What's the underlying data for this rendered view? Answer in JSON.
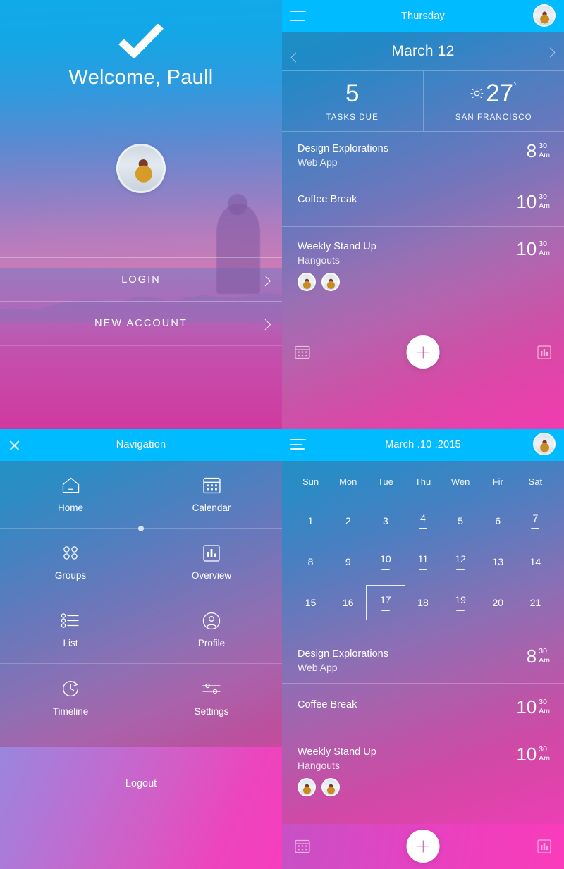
{
  "welcome": {
    "check_icon": "check-icon",
    "title": "Welcome, Paull",
    "avatar_icon": "user-avatar",
    "login_label": "LOGIN",
    "new_account_label": "NEW ACCOUNT",
    "chevron_icon": "chevron-right-icon"
  },
  "dashboard": {
    "appbar": {
      "menu_icon": "hamburger-menu-icon",
      "title": "Thursday",
      "avatar_icon": "user-avatar"
    },
    "date_nav": {
      "prev_icon": "chevron-left-icon",
      "date": "March 12",
      "next_icon": "chevron-right-icon"
    },
    "stats": [
      {
        "value": "5",
        "label": "TASKS DUE",
        "icon": ""
      },
      {
        "value": "27",
        "degree": "`",
        "label": "SAN FRANCISCO",
        "icon": "sun-icon"
      }
    ],
    "events": [
      {
        "title": "Design Explorations",
        "subtitle": "Web App",
        "hour": "8",
        "minutes": "30",
        "meridiem": "Am",
        "people": 0
      },
      {
        "title": "Coffee Break",
        "subtitle": "",
        "hour": "10",
        "minutes": "30",
        "meridiem": "Am",
        "people": 0
      },
      {
        "title": "Weekly Stand Up",
        "subtitle": "Hangouts",
        "hour": "10",
        "minutes": "30",
        "meridiem": "Am",
        "people": 2
      }
    ],
    "actions": {
      "left_icon": "calendar-icon",
      "add_icon": "plus-icon",
      "right_icon": "chart-bars-icon"
    }
  },
  "navigation": {
    "appbar": {
      "close_icon": "close-icon",
      "title": "Navigation"
    },
    "items": [
      {
        "label": "Home",
        "icon": "home-icon"
      },
      {
        "label": "Calendar",
        "icon": "calendar-icon"
      },
      {
        "label": "Groups",
        "icon": "groups-icon"
      },
      {
        "label": "Overview",
        "icon": "chart-bars-icon"
      },
      {
        "label": "List",
        "icon": "list-icon"
      },
      {
        "label": "Profile",
        "icon": "profile-icon"
      },
      {
        "label": "Timeline",
        "icon": "timeline-clock-icon"
      },
      {
        "label": "Settings",
        "icon": "sliders-icon"
      }
    ],
    "page_indicator": "page-dot",
    "logout_label": "Logout"
  },
  "calendar": {
    "appbar": {
      "menu_icon": "hamburger-menu-icon",
      "title": "March .10 ,2015",
      "avatar_icon": "user-avatar"
    },
    "weekdays": [
      "Sun",
      "Mon",
      "Tue",
      "Thu",
      "Wen",
      "Fir",
      "Sat"
    ],
    "weeks": [
      [
        {
          "day": "1",
          "event": false,
          "selected": false
        },
        {
          "day": "2",
          "event": false,
          "selected": false
        },
        {
          "day": "3",
          "event": false,
          "selected": false
        },
        {
          "day": "4",
          "event": true,
          "selected": false
        },
        {
          "day": "5",
          "event": false,
          "selected": false
        },
        {
          "day": "6",
          "event": false,
          "selected": false
        },
        {
          "day": "7",
          "event": true,
          "selected": false
        }
      ],
      [
        {
          "day": "8",
          "event": false,
          "selected": false
        },
        {
          "day": "9",
          "event": false,
          "selected": false
        },
        {
          "day": "10",
          "event": true,
          "selected": false
        },
        {
          "day": "11",
          "event": true,
          "selected": false
        },
        {
          "day": "12",
          "event": true,
          "selected": false
        },
        {
          "day": "13",
          "event": false,
          "selected": false
        },
        {
          "day": "14",
          "event": false,
          "selected": false
        }
      ],
      [
        {
          "day": "15",
          "event": false,
          "selected": false
        },
        {
          "day": "16",
          "event": false,
          "selected": false
        },
        {
          "day": "17",
          "event": true,
          "selected": true
        },
        {
          "day": "18",
          "event": false,
          "selected": false
        },
        {
          "day": "19",
          "event": true,
          "selected": false
        },
        {
          "day": "20",
          "event": false,
          "selected": false
        },
        {
          "day": "21",
          "event": false,
          "selected": false
        }
      ]
    ],
    "events": [
      {
        "title": "Design Explorations",
        "subtitle": "Web App",
        "hour": "8",
        "minutes": "30",
        "meridiem": "Am",
        "people": 0
      },
      {
        "title": "Coffee Break",
        "subtitle": "",
        "hour": "10",
        "minutes": "30",
        "meridiem": "Am",
        "people": 0
      },
      {
        "title": "Weekly Stand Up",
        "subtitle": "Hangouts",
        "hour": "10",
        "minutes": "30",
        "meridiem": "Am",
        "people": 2
      }
    ],
    "actions": {
      "left_icon": "calendar-icon",
      "add_icon": "plus-icon",
      "right_icon": "chart-bars-icon"
    }
  },
  "colors": {
    "appbar_blue": "#00bbff",
    "accent_pink": "#ef3ebd",
    "text_white": "#ffffff"
  }
}
